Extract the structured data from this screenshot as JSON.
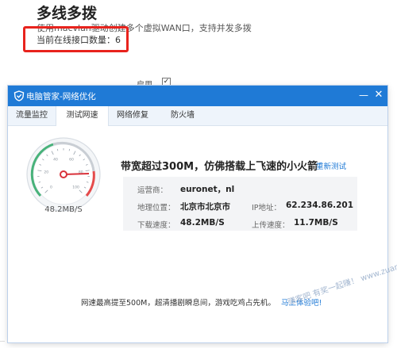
{
  "background": {
    "title": "多线多拨",
    "description": "使用macvlan驱动创建多个虚拟WAN口，支持并发多拨",
    "online_count": "当前在线接口数量：6",
    "enable_label": "启用"
  },
  "dialog": {
    "title": "电脑管家-网络优化",
    "tabs": [
      {
        "label": "流量监控"
      },
      {
        "label": "测试网速"
      },
      {
        "label": "网络修复"
      },
      {
        "label": "防火墙"
      }
    ],
    "active_tab": "测试网速",
    "gauge": {
      "speed_text": "48.2MB/S",
      "tick_labels": [
        "0",
        "20",
        "40",
        "60",
        "80",
        "100"
      ]
    },
    "headline": "带宽超过300M，仿佛搭载上飞速的小火箭",
    "retest_label": "重新测试",
    "info": {
      "isp_label": "运营商：",
      "isp_value": "euronet，nl",
      "location_label": "地理位置：",
      "location_value": "北京市北京市",
      "ip_label": "IP地址：",
      "ip_value": "62.234.86.201",
      "download_label": "下载速度：",
      "download_value": "48.2MB/S",
      "upload_label": "上传速度：",
      "upload_value": "11.7MB/S"
    },
    "promo_text": "网速最高提至500M，超清播剧瞬息间，游戏吃鸡占先机。",
    "promo_link": "马上体验吧!"
  },
  "watermark": "赚客吧 有奖一起赚！ www.zuanke8.com",
  "colors": {
    "titlebar": "#1f7ad6",
    "highlight_box": "#e8231d",
    "link": "#1f7ad6"
  }
}
